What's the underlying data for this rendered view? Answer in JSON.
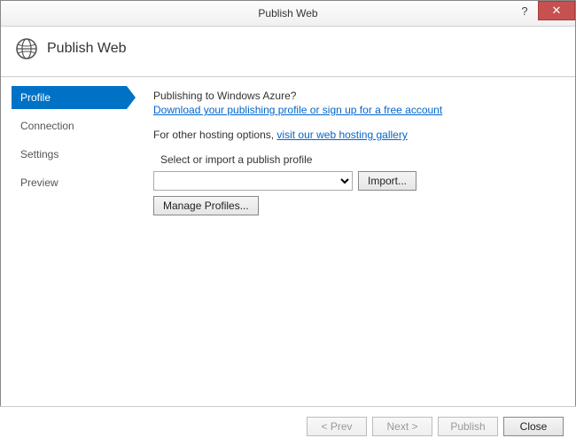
{
  "window": {
    "title": "Publish Web"
  },
  "header": {
    "title": "Publish Web"
  },
  "sidebar": {
    "items": [
      {
        "label": "Profile",
        "active": true
      },
      {
        "label": "Connection",
        "active": false
      },
      {
        "label": "Settings",
        "active": false
      },
      {
        "label": "Preview",
        "active": false
      }
    ]
  },
  "content": {
    "azure_question": "Publishing to Windows Azure?",
    "azure_link": "Download your publishing profile or sign up for a free account",
    "other_hosting_prefix": "For other hosting options, ",
    "other_hosting_link": "visit our web hosting gallery",
    "select_label": "Select or import a publish profile",
    "profile_value": "",
    "import_button": "Import...",
    "manage_button": "Manage Profiles..."
  },
  "footer": {
    "prev": "< Prev",
    "next": "Next >",
    "publish": "Publish",
    "close": "Close"
  }
}
